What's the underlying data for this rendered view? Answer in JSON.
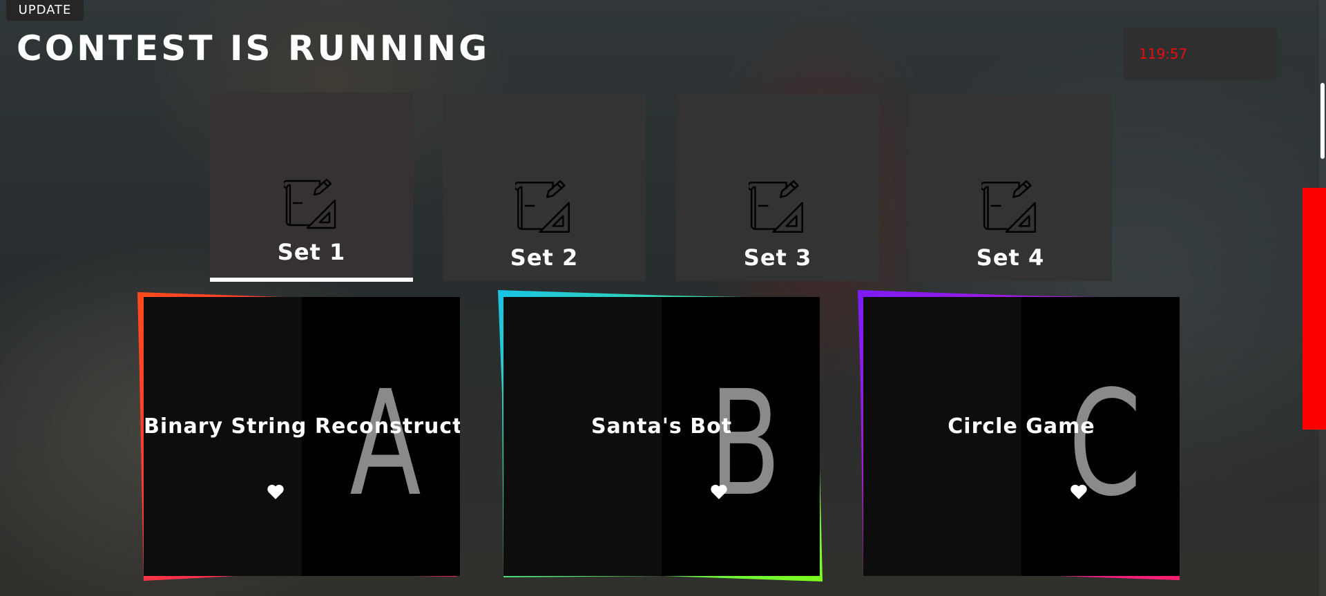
{
  "header": {
    "update_label": "UPDATE",
    "title": "CONTEST IS RUNNING",
    "timer": "119:57"
  },
  "sets": [
    {
      "label": "Set 1",
      "active": true,
      "icon": "blueprint-pencil-icon"
    },
    {
      "label": "Set 2",
      "active": false,
      "icon": "blueprint-pencil-icon"
    },
    {
      "label": "Set 3",
      "active": false,
      "icon": "blueprint-pencil-icon"
    },
    {
      "label": "Set 4",
      "active": false,
      "icon": "blueprint-pencil-icon"
    }
  ],
  "problems": [
    {
      "letter": "A",
      "name": "Binary String Reconstruction",
      "icon": "heart-icon",
      "accent_start": "#ff4a1c",
      "accent_end": "#ff1f6e"
    },
    {
      "letter": "B",
      "name": "Santa's Bot",
      "icon": "heart-icon",
      "accent_start": "#19c3e6",
      "accent_end": "#7cff1a"
    },
    {
      "letter": "C",
      "name": "Circle Game",
      "icon": "heart-icon",
      "accent_start": "#7b1bff",
      "accent_end": "#ff1f6e"
    }
  ],
  "colors": {
    "timer_text": "#e60e0e",
    "scrollbar": "#fa0000",
    "card_bg": "#333333"
  }
}
